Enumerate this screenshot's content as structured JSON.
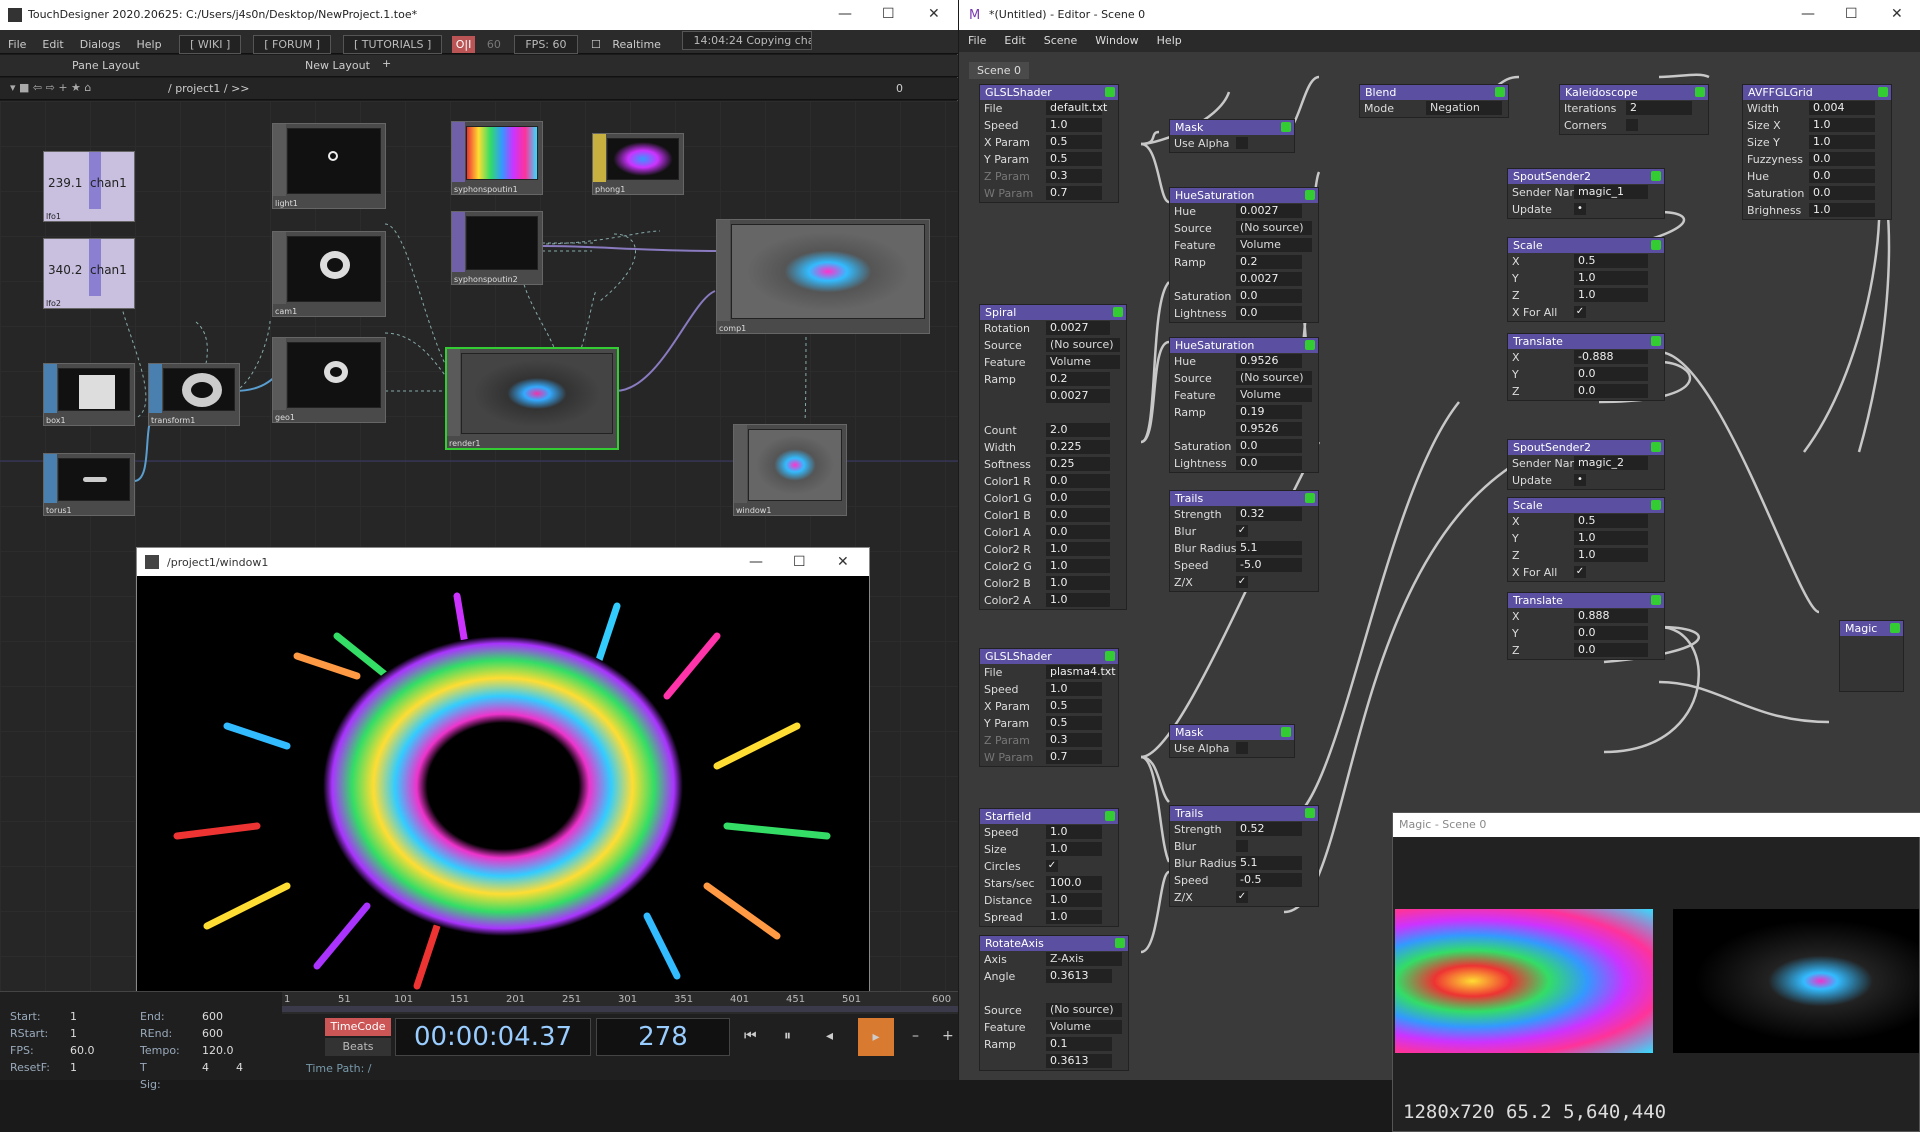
{
  "td": {
    "title": "TouchDesigner 2020.20625: C:/Users/j4s0n/Desktop/NewProject.1.toe*",
    "menu": [
      "File",
      "Edit",
      "Dialogs",
      "Help"
    ],
    "links": [
      "[ WIKI ]",
      "[ FORUM ]",
      "[ TUTORIALS ]"
    ],
    "oi": "O|I",
    "fps_box": "60",
    "fps": "FPS:  60",
    "realtime": "Realtime",
    "status": "14:04:24 Copying cha",
    "pane_layout": "Pane Layout",
    "new_layout": "New Layout",
    "path": "/ project1 / >>",
    "path_num": "0",
    "nodes": [
      {
        "name": "lfo1",
        "val": "239.1",
        "ch": "chan1"
      },
      {
        "name": "lfo2",
        "val": "340.2",
        "ch": "chan1"
      },
      {
        "name": "box1"
      },
      {
        "name": "transform1"
      },
      {
        "name": "torus1"
      },
      {
        "name": "light1"
      },
      {
        "name": "cam1"
      },
      {
        "name": "geo1"
      },
      {
        "name": "syphonspoutin1"
      },
      {
        "name": "syphonspoutin2"
      },
      {
        "name": "phong1"
      },
      {
        "name": "render1"
      },
      {
        "name": "comp1"
      },
      {
        "name": "window1"
      }
    ],
    "preview_title": "/project1/window1",
    "timeline": {
      "start_l": "Start:",
      "start": "1",
      "end_l": "End:",
      "end": "600",
      "rstart_l": "RStart:",
      "rstart": "1",
      "rend_l": "REnd:",
      "rend": "600",
      "fps_l": "FPS:",
      "fps": "60.0",
      "tempo_l": "Tempo:",
      "tempo": "120.0",
      "resetf_l": "ResetF:",
      "resetf": "1",
      "tsig_l": "T Sig:",
      "tsig1": "4",
      "tsig2": "4",
      "ticks": [
        "1",
        "51",
        "101",
        "151",
        "201",
        "251",
        "301",
        "351",
        "401",
        "451",
        "501",
        "600"
      ],
      "timecode": "TimeCode",
      "beats": "Beats",
      "time": "00:00:04.37",
      "frame": "278",
      "timepath": "Time Path: /"
    }
  },
  "ed": {
    "title": "*(Untitled) - Editor - Scene 0",
    "menu": [
      "File",
      "Edit",
      "Scene",
      "Window",
      "Help"
    ],
    "tab": "Scene 0",
    "preview_title": "Magic - Scene 0",
    "preview_stats": "1280x720  65.2  5,640,440",
    "modules": {
      "glsl1": {
        "title": "GLSLShader",
        "rows": [
          [
            "File",
            "default.txt"
          ],
          [
            "Speed",
            "1.0"
          ],
          [
            "X Param",
            "0.5"
          ],
          [
            "Y Param",
            "0.5"
          ],
          [
            "Z Param",
            "0.3"
          ],
          [
            "W Param",
            "0.7"
          ]
        ]
      },
      "mask1": {
        "title": "Mask",
        "rows": [
          [
            "Use Alpha",
            ""
          ]
        ]
      },
      "hue1": {
        "title": "HueSaturation",
        "rows": [
          [
            "Hue",
            "0.0027"
          ],
          [
            "Source",
            "(No source)"
          ],
          [
            "Feature",
            "Volume"
          ],
          [
            "Ramp",
            "0.2"
          ],
          [
            "",
            "0.0027"
          ],
          [
            "Saturation",
            "0.0"
          ],
          [
            "Lightness",
            "0.0"
          ]
        ]
      },
      "hue2": {
        "title": "HueSaturation",
        "rows": [
          [
            "Hue",
            "0.9526"
          ],
          [
            "Source",
            "(No source)"
          ],
          [
            "Feature",
            "Volume"
          ],
          [
            "Ramp",
            "0.19"
          ],
          [
            "",
            "0.9526"
          ],
          [
            "Saturation",
            "0.0"
          ],
          [
            "Lightness",
            "0.0"
          ]
        ]
      },
      "trails1": {
        "title": "Trails",
        "rows": [
          [
            "Strength",
            "0.32"
          ],
          [
            "Blur",
            "✓"
          ],
          [
            "Blur Radius",
            "5.1"
          ],
          [
            "Speed",
            "-5.0"
          ],
          [
            "Z/X",
            "✓"
          ]
        ]
      },
      "spiral": {
        "title": "Spiral",
        "rows": [
          [
            "Rotation",
            "0.0027"
          ],
          [
            "Source",
            "(No source)"
          ],
          [
            "Feature",
            "Volume"
          ],
          [
            "Ramp",
            "0.2"
          ],
          [
            "",
            "0.0027"
          ],
          [
            "",
            ""
          ],
          [
            "Count",
            "2.0"
          ],
          [
            "Width",
            "0.225"
          ],
          [
            "Softness",
            "0.25"
          ],
          [
            "Color1 R",
            "0.0"
          ],
          [
            "Color1 G",
            "0.0"
          ],
          [
            "Color1 B",
            "0.0"
          ],
          [
            "Color1 A",
            "0.0"
          ],
          [
            "Color2 R",
            "1.0"
          ],
          [
            "Color2 G",
            "1.0"
          ],
          [
            "Color2 B",
            "1.0"
          ],
          [
            "Color2 A",
            "1.0"
          ]
        ]
      },
      "blend": {
        "title": "Blend",
        "rows": [
          [
            "Mode",
            "Negation"
          ]
        ]
      },
      "kaleido": {
        "title": "Kaleidoscope",
        "rows": [
          [
            "Iterations",
            "2"
          ],
          [
            "Corners",
            ""
          ]
        ]
      },
      "avf": {
        "title": "AVFFGLGrid",
        "rows": [
          [
            "Width",
            "0.004"
          ],
          [
            "Size X",
            "1.0"
          ],
          [
            "Size Y",
            "1.0"
          ],
          [
            "Fuzzyness",
            "0.0"
          ],
          [
            "Hue",
            "0.0"
          ],
          [
            "Saturation",
            "0.0"
          ],
          [
            "Brighness",
            "1.0"
          ]
        ]
      },
      "spout1": {
        "title": "SpoutSender2",
        "rows": [
          [
            "Sender Name",
            "magic_1"
          ],
          [
            "Update",
            "•"
          ]
        ]
      },
      "scale1": {
        "title": "Scale",
        "rows": [
          [
            "X",
            "0.5"
          ],
          [
            "Y",
            "1.0"
          ],
          [
            "Z",
            "1.0"
          ],
          [
            "X For All",
            "✓"
          ]
        ]
      },
      "trans1": {
        "title": "Translate",
        "rows": [
          [
            "X",
            "-0.888"
          ],
          [
            "Y",
            "0.0"
          ],
          [
            "Z",
            "0.0"
          ]
        ]
      },
      "spout2": {
        "title": "SpoutSender2",
        "rows": [
          [
            "Sender Name",
            "magic_2"
          ],
          [
            "Update",
            "•"
          ]
        ]
      },
      "scale2": {
        "title": "Scale",
        "rows": [
          [
            "X",
            "0.5"
          ],
          [
            "Y",
            "1.0"
          ],
          [
            "Z",
            "1.0"
          ],
          [
            "X For All",
            "✓"
          ]
        ]
      },
      "trans2": {
        "title": "Translate",
        "rows": [
          [
            "X",
            "0.888"
          ],
          [
            "Y",
            "0.0"
          ],
          [
            "Z",
            "0.0"
          ]
        ]
      },
      "magic": {
        "title": "Magic",
        "rows": []
      },
      "glsl2": {
        "title": "GLSLShader",
        "rows": [
          [
            "File",
            "plasma4.txt"
          ],
          [
            "Speed",
            "1.0"
          ],
          [
            "X Param",
            "0.5"
          ],
          [
            "Y Param",
            "0.5"
          ],
          [
            "Z Param",
            "0.3"
          ],
          [
            "W Param",
            "0.7"
          ]
        ]
      },
      "mask2": {
        "title": "Mask",
        "rows": [
          [
            "Use Alpha",
            ""
          ]
        ]
      },
      "starfield": {
        "title": "Starfield",
        "rows": [
          [
            "Speed",
            "1.0"
          ],
          [
            "Size",
            "1.0"
          ],
          [
            "Circles",
            "✓"
          ],
          [
            "Stars/sec",
            "100.0"
          ],
          [
            "Distance",
            "1.0"
          ],
          [
            "Spread",
            "1.0"
          ]
        ]
      },
      "trails2": {
        "title": "Trails",
        "rows": [
          [
            "Strength",
            "0.52"
          ],
          [
            "Blur",
            ""
          ],
          [
            "Blur Radius",
            "5.1"
          ],
          [
            "Speed",
            "-0.5"
          ],
          [
            "Z/X",
            "✓"
          ]
        ]
      },
      "rotate": {
        "title": "RotateAxis",
        "rows": [
          [
            "Axis",
            "Z-Axis"
          ],
          [
            "Angle",
            "0.3613"
          ],
          [
            "",
            ""
          ],
          [
            "Source",
            "(No source)"
          ],
          [
            "Feature",
            "Volume"
          ],
          [
            "Ramp",
            "0.1"
          ],
          [
            "",
            "0.3613"
          ]
        ]
      }
    }
  }
}
